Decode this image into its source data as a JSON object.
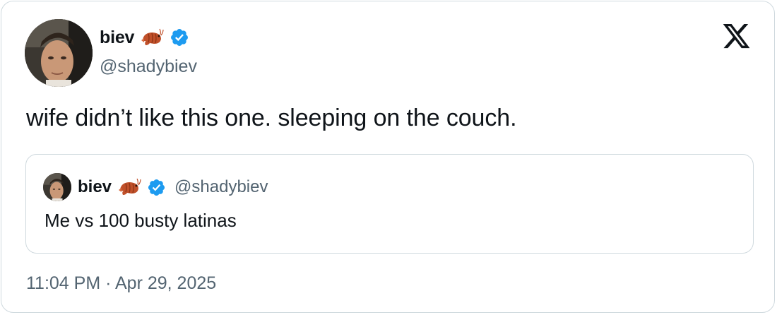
{
  "tweet": {
    "author": {
      "display_name": "biev",
      "handle": "@shadybiev",
      "emoji": "shrimp",
      "verified": true,
      "verified_color": "#1d9bf0"
    },
    "text": "wife didn’t like this one. sleeping on the couch.",
    "timestamp": "11:04 PM · Apr 29, 2025",
    "quoted": {
      "author": {
        "display_name": "biev",
        "handle": "@shadybiev",
        "emoji": "shrimp",
        "verified": true
      },
      "text": "Me vs 100 busty latinas"
    }
  },
  "logo": "x-logo-icon",
  "colors": {
    "text_primary": "#0f1419",
    "text_secondary": "#536471",
    "border": "#cfd9de",
    "verified": "#1d9bf0",
    "shrimp": "#c0502a"
  }
}
